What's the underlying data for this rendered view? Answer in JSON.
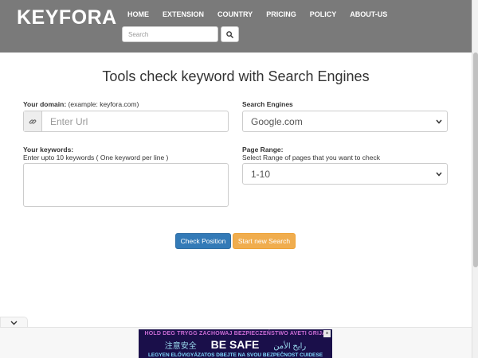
{
  "brand": "KEYFORA",
  "nav": {
    "items": [
      {
        "label": "HOME"
      },
      {
        "label": "EXTENSION"
      },
      {
        "label": "COUNTRY"
      },
      {
        "label": "PRICING"
      },
      {
        "label": "POLICY"
      },
      {
        "label": "ABOUT-US"
      }
    ],
    "search_placeholder": "Search"
  },
  "main": {
    "title": "Tools check keyword with Search Engines",
    "domain": {
      "label": "Your domain:",
      "hint": " (example: keyfora.com)",
      "placeholder": "Enter Url"
    },
    "engines": {
      "label": "Search Engines",
      "selected": "Google.com"
    },
    "keywords": {
      "label": "Your keywords:",
      "sublabel": "Enter upto 10 keywords ( One keyword per line )",
      "value": ""
    },
    "range": {
      "label": "Page Range:",
      "sublabel": "Select Range of pages that you want to check",
      "selected": "1-10"
    },
    "buttons": {
      "check": "Check Position",
      "new_search": "Start new Search"
    }
  },
  "ad": {
    "line1": "HOLD DEG TRYGG  ZACHOWAJ BEZPIECZEŃSTWO  AVETI GRIJA",
    "left_text": "注意安全",
    "main_text": "BE SAFE",
    "right_text": "رايح الأمن",
    "line3": "LEGYEN ELŐVIGYÁZATOS  DBEJTE NA SVOU BEZPEČNOST  CUIDESE"
  },
  "colors": {
    "header_bg": "#7a7a7a",
    "primary": "#337ab7",
    "warning": "#f0ad4e"
  }
}
